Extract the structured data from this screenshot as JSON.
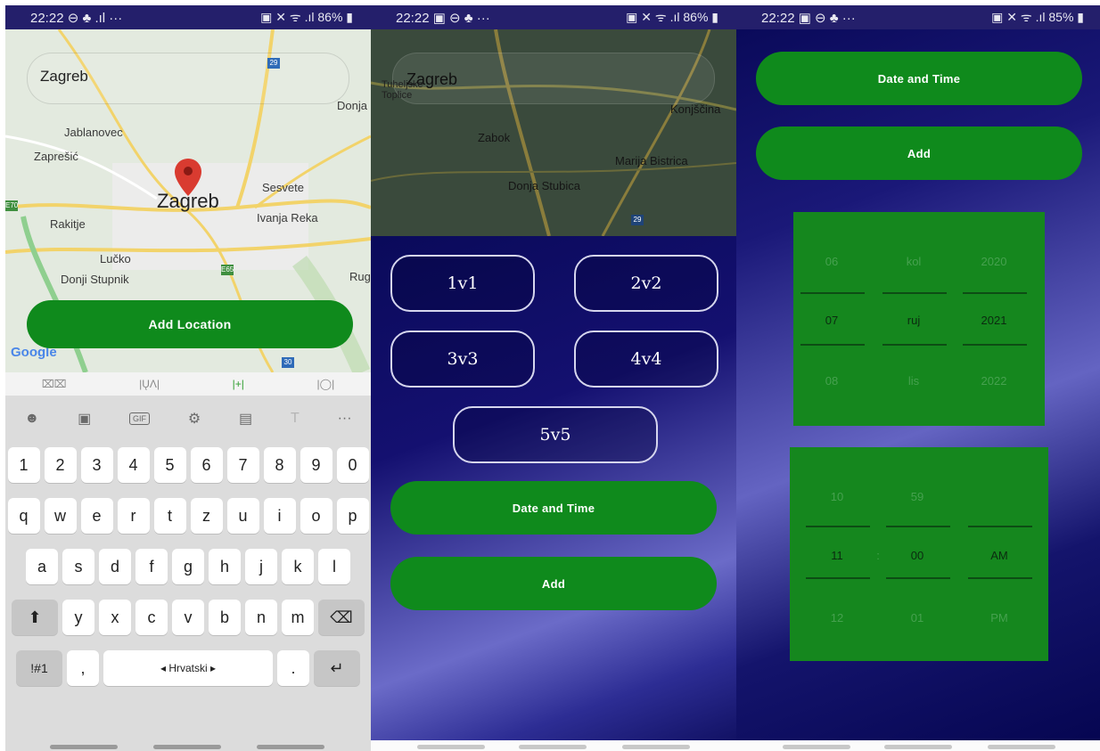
{
  "status": [
    {
      "time": "22:22",
      "left_icons": "⊖ ♣ .ıl ···",
      "right": "86%"
    },
    {
      "time": "22:22",
      "left_icons": "▣ ⊖ ♣ ···",
      "right": "86%"
    },
    {
      "time": "22:22",
      "left_icons": "▣ ⊖ ♣ ···",
      "right": "85%"
    }
  ],
  "panel1": {
    "search_value": "Zagreb",
    "map_labels": {
      "donja": "Donja",
      "jablanovec": "Jablanovec",
      "zapresic": "Zaprešić",
      "zagreb": "Zagreb",
      "sesvete": "Sesvete",
      "rakitje": "Rakitje",
      "ivanja": "Ivanja Reka",
      "lucko": "Lučko",
      "donji": "Donji Stupnik",
      "rug": "Rug",
      "google": "Google",
      "e70": "E70",
      "e65": "E65",
      "r29": "29",
      "r30": "30"
    },
    "add_location": "Add Location",
    "suggestions": [
      "⌧⌧",
      "|ŲΛ|",
      "|+|",
      "|◯|"
    ],
    "tool_icons": [
      "emoji-icon",
      "sticker-icon",
      "gif-icon",
      "gear-icon",
      "clipboard-icon",
      "text-style-icon",
      "more-icon"
    ],
    "tool_glyphs": {
      "emoji": "☻",
      "sticker": "▣",
      "gif": "GIF",
      "gear": "⚙",
      "clipboard": "▤",
      "textstyle": "T",
      "more": "···"
    },
    "keys_row1": [
      "1",
      "2",
      "3",
      "4",
      "5",
      "6",
      "7",
      "8",
      "9",
      "0"
    ],
    "keys_row2": [
      "q",
      "w",
      "e",
      "r",
      "t",
      "z",
      "u",
      "i",
      "o",
      "p"
    ],
    "keys_row3": [
      "a",
      "s",
      "d",
      "f",
      "g",
      "h",
      "j",
      "k",
      "l"
    ],
    "keys_row4": [
      "y",
      "x",
      "c",
      "v",
      "b",
      "n",
      "m"
    ],
    "shift": "⬆",
    "backspace": "⌫",
    "sym": "!#1",
    "comma": ",",
    "space": "◂ Hrvatski ▸",
    "period": ".",
    "enter": "↵"
  },
  "panel2": {
    "map_labels": {
      "zagreb": "Zagreb",
      "toplice": "Tuheljske\nToplice",
      "konjscina": "Konjščina",
      "zabok": "Zabok",
      "marija": "Marija Bistrica",
      "stubica": "Donja Stubica",
      "r29": "29"
    },
    "modes": [
      "1v1",
      "2v2",
      "3v3",
      "4v4",
      "5v5"
    ],
    "date_time": "Date and Time",
    "add": "Add"
  },
  "panel3": {
    "date_time": "Date and Time",
    "add": "Add",
    "date_picker": {
      "prev": [
        "06",
        "kol",
        "2020"
      ],
      "selected": [
        "07",
        "ruj",
        "2021"
      ],
      "next": [
        "08",
        "lis",
        "2022"
      ]
    },
    "time_picker": {
      "prev": [
        "10",
        "59",
        ""
      ],
      "selected": [
        "11",
        ":",
        "00",
        "AM"
      ],
      "next": [
        "12",
        "01",
        "PM"
      ]
    }
  },
  "colors": {
    "accent_green": "#0f8a1c",
    "picker_green": "#15871e",
    "status_bar": "#241f6b"
  }
}
